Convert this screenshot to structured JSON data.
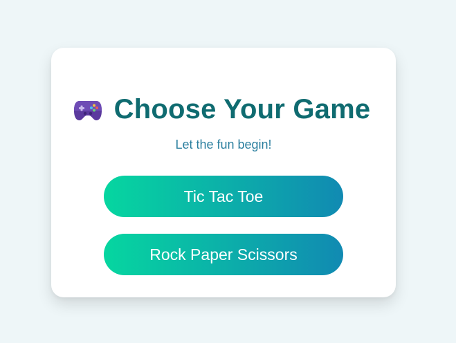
{
  "header": {
    "icon": "game-controller-icon",
    "title": "Choose Your Game",
    "subtitle": "Let the fun begin!"
  },
  "games": [
    {
      "label": "Tic Tac Toe"
    },
    {
      "label": "Rock Paper Scissors"
    }
  ],
  "colors": {
    "page_bg": "#eef6f8",
    "card_bg": "#ffffff",
    "title": "#0f6b70",
    "subtitle": "#2b7f9f",
    "button_gradient_start": "#06d6a0",
    "button_gradient_end": "#118ab2",
    "button_text": "#ffffff"
  }
}
